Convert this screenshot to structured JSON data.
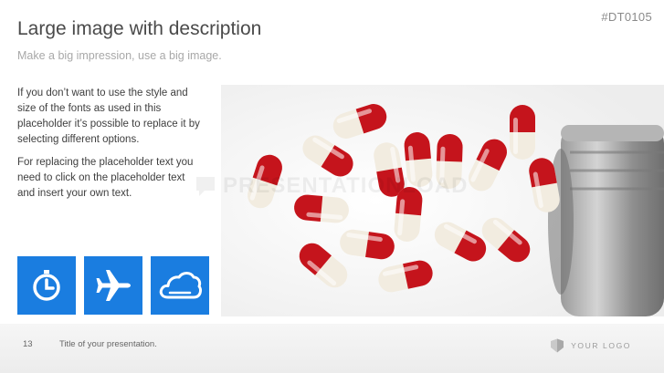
{
  "slide": {
    "code": "#DT0105",
    "title": "Large image with description",
    "subtitle": "Make a big impression, use a big image.",
    "paragraphs": [
      "If you don’t want to use the style and size of the fonts as used in this placeholder it’s possible to replace it by selecting different options.",
      "For replacing the placeholder text you need to click on the placeholder text and insert your own text."
    ],
    "icons": [
      "stopwatch-icon",
      "airplane-icon",
      "cloud-icon"
    ],
    "accent_color": "#1a7de0",
    "watermark": "PRESENTATIONLOAD"
  },
  "footer": {
    "page_number": "13",
    "title": "Title of your presentation.",
    "logo_text": "YOUR LOGO"
  }
}
